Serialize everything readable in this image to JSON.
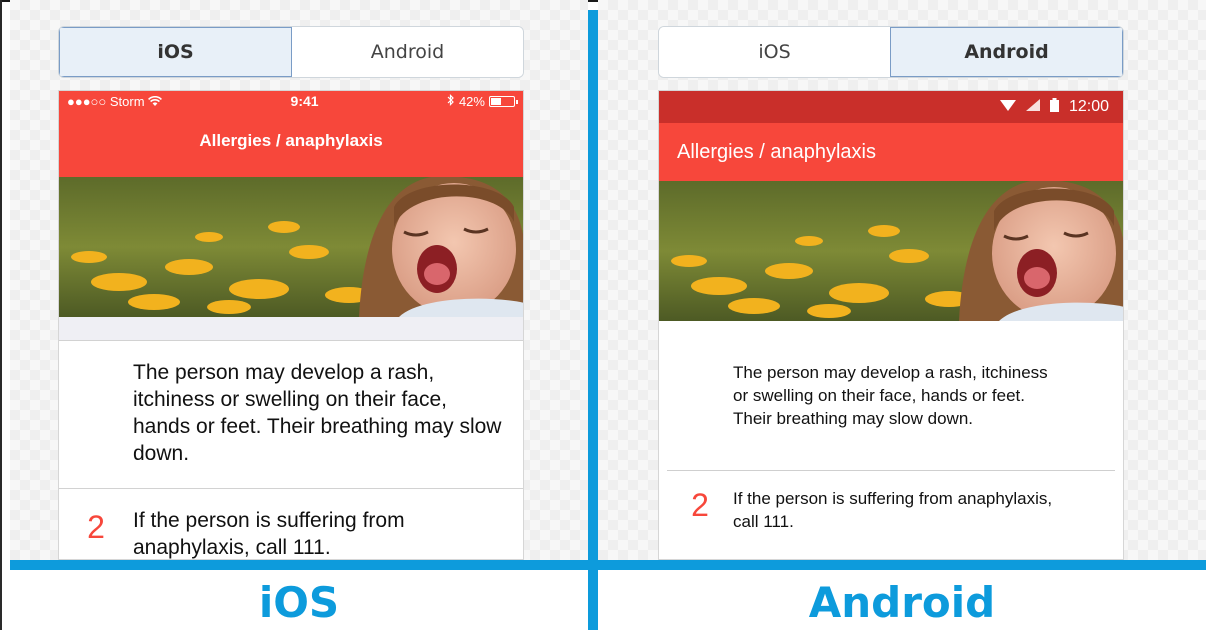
{
  "left": {
    "toggle": {
      "ios_label": "iOS",
      "android_label": "Android",
      "active": "iOS"
    },
    "status": {
      "carrier": "●●●○○ Storm",
      "time": "9:41",
      "battery": "42%"
    },
    "nav_title": "Allergies / anaphylaxis",
    "step1_text": "The person may develop a rash, itchiness or swelling on their face, hands or feet. Their breathing may slow down.",
    "step2_number": "2",
    "step2_text": "If the person is suffering from anaphylaxis, call 111.",
    "caption": "iOS"
  },
  "right": {
    "toggle": {
      "ios_label": "iOS",
      "android_label": "Android",
      "active": "Android"
    },
    "status": {
      "time": "12:00"
    },
    "nav_title": "Allergies / anaphylaxis",
    "step1_text": "The person may develop a rash, itchiness or swelling on their face, hands or feet. Their breathing may slow down.",
    "step2_number": "2",
    "step2_text": "If the person is suffering from anaphylaxis, call 111.",
    "caption": "Android"
  },
  "colors": {
    "accent_blue": "#0d9bdc",
    "app_red": "#f7473b",
    "android_status_red": "#c92f2a"
  },
  "icons": [
    "wifi-icon",
    "bluetooth-icon",
    "battery-icon",
    "signal-icon"
  ]
}
